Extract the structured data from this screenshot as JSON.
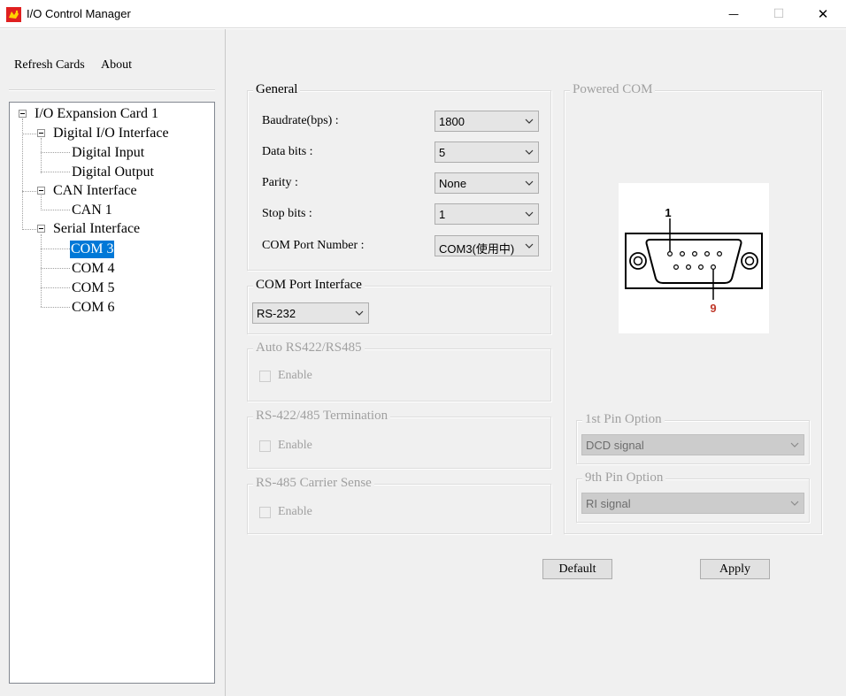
{
  "window": {
    "title": "I/O Control Manager",
    "min_glyph": "—",
    "max_glyph": "☐",
    "close_glyph": "✕",
    "app_icon": "red-dragon-app-icon"
  },
  "menu": {
    "refresh_label": "Refresh Cards",
    "about_label": "About"
  },
  "tree": {
    "card": "I/O Expansion Card 1",
    "digital_io": "Digital I/O Interface",
    "digital_input": "Digital Input",
    "digital_output": "Digital Output",
    "can_interface": "CAN Interface",
    "can1": "CAN 1",
    "serial_interface": "Serial Interface",
    "com3": "COM 3",
    "com4": "COM 4",
    "com5": "COM 5",
    "com6": "COM 6"
  },
  "general": {
    "title": "General",
    "baudrate_label": "Baudrate(bps) :",
    "baudrate_value": "1800",
    "databits_label": "Data bits :",
    "databits_value": "5",
    "parity_label": "Parity :",
    "parity_value": "None",
    "stopbits_label": "Stop bits :",
    "stopbits_value": "1",
    "comport_label": "COM Port Number :",
    "comport_value": "COM3(使用中)"
  },
  "com_interface": {
    "title": "COM Port Interface",
    "value": "RS-232"
  },
  "auto_rs": {
    "title": "Auto RS422/RS485",
    "enable_label": "Enable"
  },
  "termination": {
    "title": "RS-422/485 Termination",
    "enable_label": "Enable"
  },
  "carrier": {
    "title": "RS-485 Carrier Sense",
    "enable_label": "Enable"
  },
  "powered_com": {
    "title": "Powered COM",
    "pin1_label": "1",
    "pin9_label": "9",
    "pin1_option_title": "1st Pin Option",
    "pin1_option_value": "DCD signal",
    "pin9_option_title": "9th Pin Option",
    "pin9_option_value": "RI signal"
  },
  "buttons": {
    "default_label": "Default",
    "apply_label": "Apply"
  },
  "colors": {
    "selection": "#0078d7",
    "pin9_label": "#c0392b",
    "disabled_text": "#a0a0a0"
  }
}
